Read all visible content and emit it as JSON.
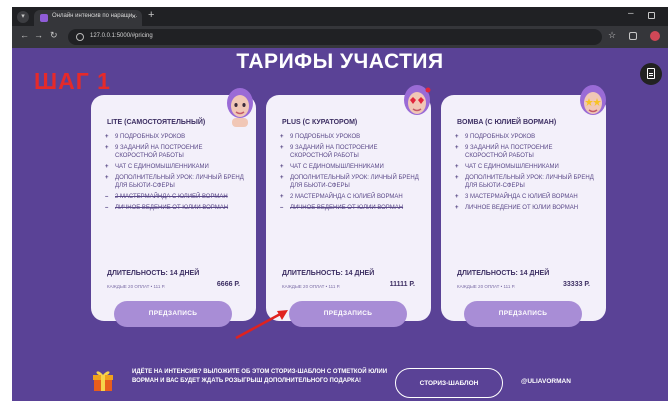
{
  "browser": {
    "tab_title": "Онлайн интенсив по наращи...",
    "url": "127.0.0.1:5000/#pricing"
  },
  "page": {
    "title": "ТАРИФЫ УЧАСТИЯ",
    "step_label": "ШАГ 1",
    "cards": [
      {
        "title": "LITE (САМОСТОЯТЕЛЬНЫЙ)",
        "features": [
          {
            "mark": "+",
            "text": "9 ПОДРОБНЫХ УРОКОВ"
          },
          {
            "mark": "+",
            "text": "9 ЗАДАНИЙ НА ПОСТРОЕНИЕ СКОРОСТНОЙ РАБОТЫ"
          },
          {
            "mark": "+",
            "text": "ЧАТ С ЕДИНОМЫШЛЕННИКАМИ"
          },
          {
            "mark": "+",
            "text": "ДОПОЛНИТЕЛЬНЫЙ УРОК: ЛИЧНЫЙ БРЕНД ДЛЯ БЬЮТИ-СФЕРЫ"
          },
          {
            "mark": "–",
            "text": "2 МАСТЕРМАЙНДА С ЮЛИЕЙ ВОРМАН"
          },
          {
            "mark": "–",
            "text": "ЛИЧНОЕ ВЕДЕНИЕ ОТ ЮЛИИ ВОРМАН"
          }
        ],
        "duration": "ДЛИТЕЛЬНОСТЬ: 14 ДНЕЙ",
        "installment": "КАЖДЫЕ 20 ОПЛАТ • 111 Р.",
        "price": "6666 Р.",
        "cta": "ПРЕДЗАПИСЬ"
      },
      {
        "title": "PLUS (С КУРАТОРОМ)",
        "features": [
          {
            "mark": "+",
            "text": "9 ПОДРОБНЫХ УРОКОВ"
          },
          {
            "mark": "+",
            "text": "9 ЗАДАНИЙ НА ПОСТРОЕНИЕ СКОРОСТНОЙ РАБОТЫ"
          },
          {
            "mark": "+",
            "text": "ЧАТ С ЕДИНОМЫШЛЕННИКАМИ"
          },
          {
            "mark": "+",
            "text": "ДОПОЛНИТЕЛЬНЫЙ УРОК: ЛИЧНЫЙ БРЕНД ДЛЯ БЬЮТИ-СФЕРЫ"
          },
          {
            "mark": "+",
            "text": "2 МАСТЕРМАЙНДА С ЮЛИЕЙ ВОРМАН"
          },
          {
            "mark": "–",
            "text": "ЛИЧНОЕ ВЕДЕНИЕ ОТ ЮЛИИ ВОРМАН"
          }
        ],
        "duration": "ДЛИТЕЛЬНОСТЬ: 14 ДНЕЙ",
        "installment": "КАЖДЫЕ 20 ОПЛАТ • 111 Р.",
        "price": "11111 Р.",
        "cta": "ПРЕДЗАПИСЬ"
      },
      {
        "title": "BOMBA (С ЮЛИЕЙ ВОРМАН)",
        "features": [
          {
            "mark": "+",
            "text": "9 ПОДРОБНЫХ УРОКОВ"
          },
          {
            "mark": "+",
            "text": "9 ЗАДАНИЙ НА ПОСТРОЕНИЕ СКОРОСТНОЙ РАБОТЫ"
          },
          {
            "mark": "+",
            "text": "ЧАТ С ЕДИНОМЫШЛЕННИКАМИ"
          },
          {
            "mark": "+",
            "text": "ДОПОЛНИТЕЛЬНЫЙ УРОК: ЛИЧНЫЙ БРЕНД ДЛЯ БЬЮТИ-СФЕРЫ"
          },
          {
            "mark": "+",
            "text": "3 МАСТЕРМАЙНДА С ЮЛИЕЙ ВОРМАН"
          },
          {
            "mark": "+",
            "text": "ЛИЧНОЕ ВЕДЕНИЕ ОТ ЮЛИИ ВОРМАН"
          }
        ],
        "duration": "ДЛИТЕЛЬНОСТЬ: 14 ДНЕЙ",
        "installment": "КАЖДЫЕ 20 ОПЛАТ • 111 Р.",
        "price": "33333 Р.",
        "cta": "ПРЕДЗАПИСЬ"
      }
    ],
    "banner": {
      "text": "ИДЁТЕ НА ИНТЕНСИВ? ВЫЛОЖИТЕ ОБ ЭТОМ СТОРИЗ-ШАБЛОН С ОТМЕТКОЙ ЮЛИИ ВОРМАН И ВАС БУДЕТ ЖДАТЬ РОЗЫГРЫШ ДОПОЛНИТЕЛЬНОГО ПОДАРКА!",
      "button": "СТОРИЗ-ШАБЛОН",
      "handle": "@ULIAVORMAN"
    }
  },
  "colors": {
    "page_bg": "#5a4296",
    "card_bg": "#f3f0fa",
    "cta_bg": "#a88dd6",
    "step_red": "#e52a2a",
    "arrow_red": "#e0221f"
  },
  "icons": {
    "tab_menu": "chevron-down-icon",
    "favicon": "site-favicon-icon",
    "back": "back-arrow-icon",
    "forward": "forward-arrow-icon",
    "reload": "reload-icon",
    "lock": "site-info-icon",
    "bookmark": "star-icon",
    "extensions": "extensions-icon",
    "document": "document-icon",
    "gift": "gift-icon"
  }
}
